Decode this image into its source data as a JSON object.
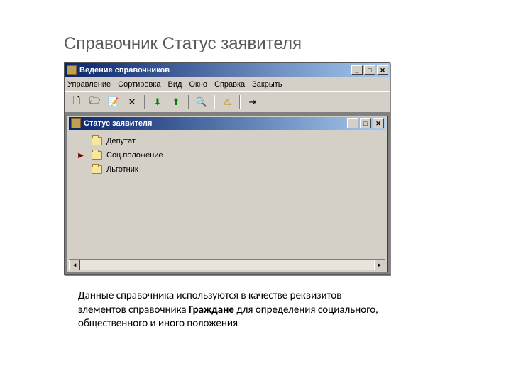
{
  "slide": {
    "title": "Справочник Статус заявителя"
  },
  "main_window": {
    "title": "Ведение справочников",
    "menu": {
      "m0": "Управление",
      "m1": "Сортировка",
      "m2": "Вид",
      "m3": "Окно",
      "m4": "Справка",
      "m5": "Закрыть"
    },
    "toolbar": {
      "new": "🗋",
      "open": "🗁",
      "edit": "📝",
      "delete": "✕",
      "down": "⬇",
      "up": "⬆",
      "find": "🔍",
      "warn": "⚠",
      "exit": "⇥"
    }
  },
  "child_window": {
    "title": "Статус заявителя",
    "items": {
      "i0": "Депутат",
      "i1": "Соц.положение",
      "i2": "Льготник"
    },
    "marker": "▶"
  },
  "caption": {
    "part1": "Данные справочника используются в качестве реквизитов элементов справочника ",
    "bold": "Граждане",
    "part2": " для определения социального, общественного и иного положения"
  },
  "winctl": {
    "min": "_",
    "max": "□",
    "close": "✕"
  },
  "scroll": {
    "left": "◄",
    "right": "►"
  }
}
